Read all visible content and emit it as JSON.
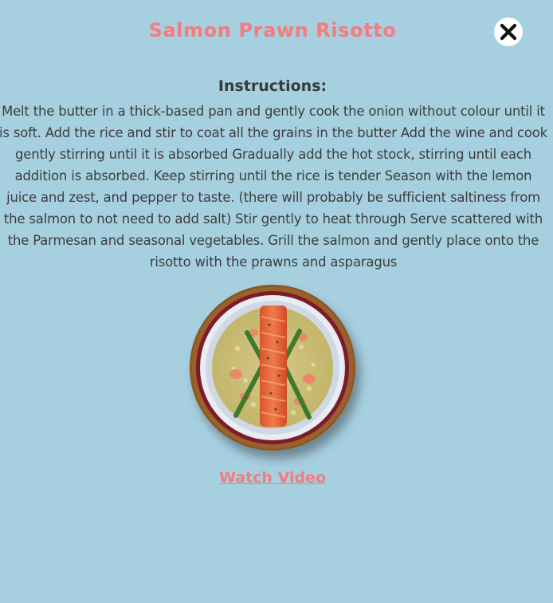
{
  "recipe": {
    "title": "Salmon Prawn Risotto",
    "instructions_heading": "Instructions:",
    "instructions": "Melt the butter in a thick-based pan and gently cook the onion without colour until it is soft. Add the rice and stir to coat all the grains in the butter Add the wine and cook gently stirring until it is absorbed Gradually add the hot stock, stirring until each addition is absorbed. Keep stirring until the rice is tender Season with the lemon juice and zest, and pepper to taste. (there will probably be sufficient saltiness from the salmon to not need to add salt) Stir gently to heat through Serve scattered with the Parmesan and seasonal vegetables. Grill the salmon and gently place onto the risotto with the prawns and asparagus",
    "video_link": "Watch Video"
  },
  "icons": {
    "close": "close-icon"
  },
  "colors": {
    "background": "#a6cfdf",
    "accent": "#f47c7c",
    "text": "#3d3d3d"
  }
}
